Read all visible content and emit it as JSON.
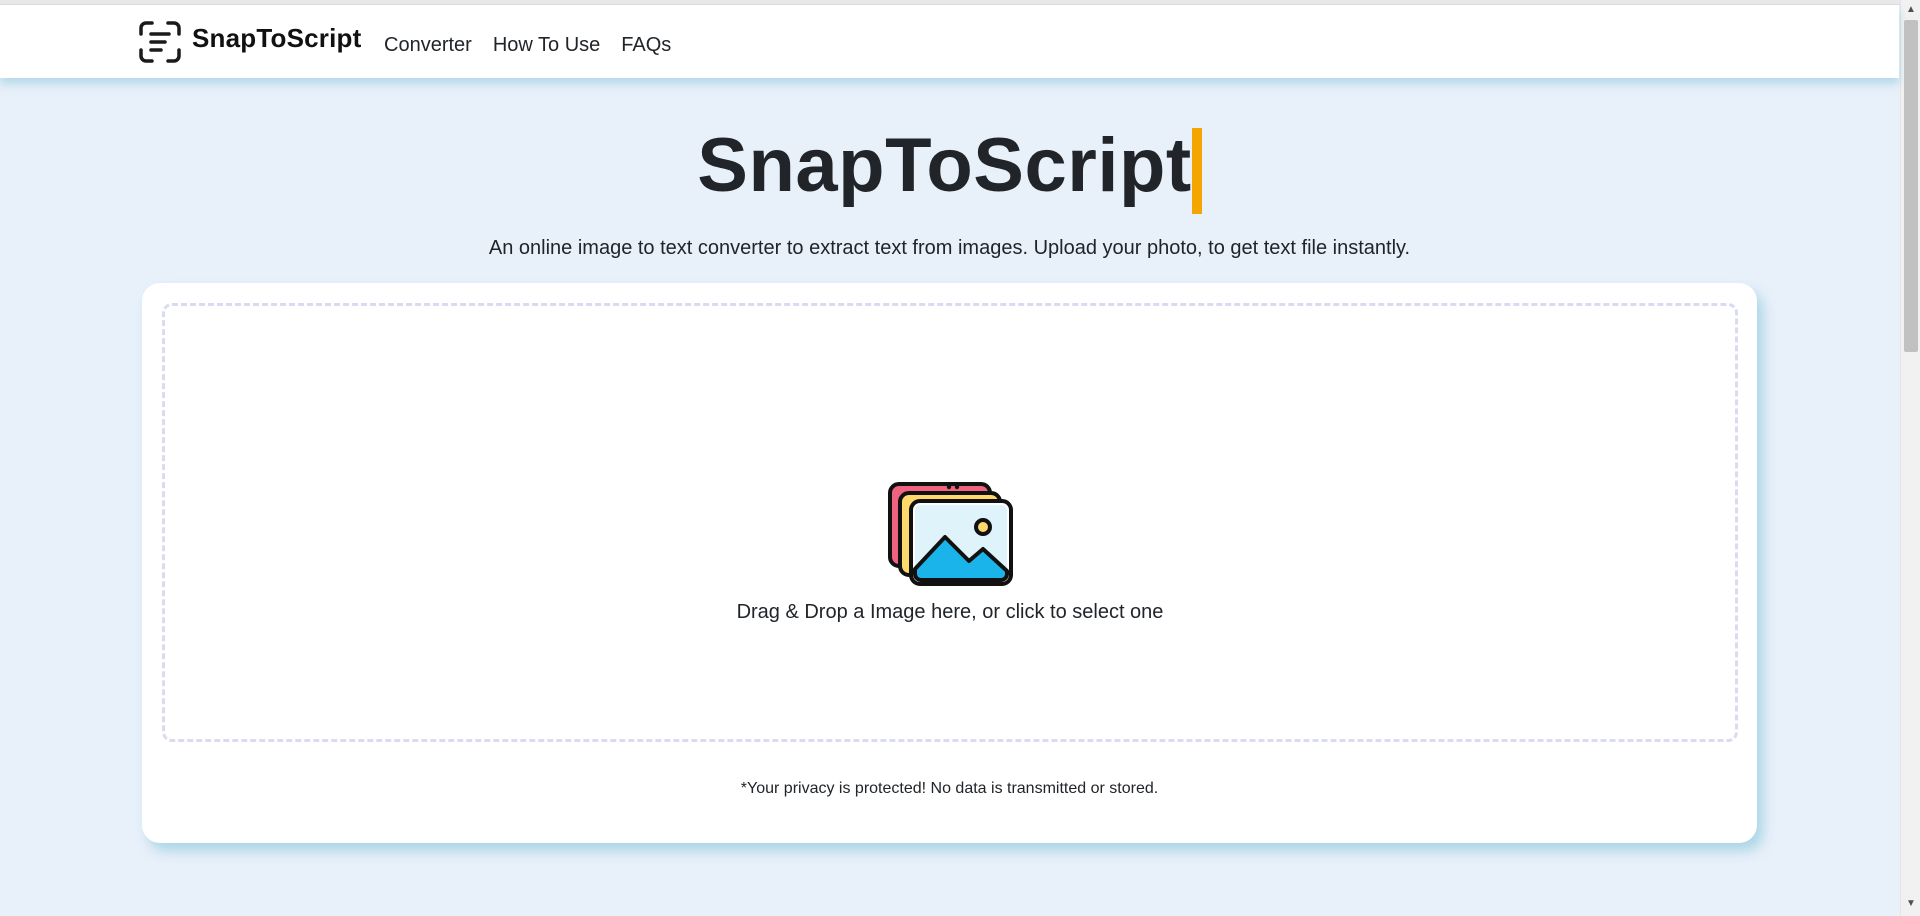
{
  "app": {
    "brand_name": "SnapToScript",
    "accent_color": "#f5a500",
    "background_color": "#e8f0fa"
  },
  "nav": {
    "links": [
      {
        "label": "Converter"
      },
      {
        "label": "How To Use"
      },
      {
        "label": "FAQs"
      }
    ]
  },
  "hero": {
    "title": "SnapToScript",
    "subtitle": "An online image to text converter to extract text from images. Upload your photo, to get text file instantly."
  },
  "upload": {
    "icon": "images-stack-icon",
    "prompt": "Drag & Drop a Image here, or click to select one",
    "privacy_note": "*Your privacy is protected! No data is transmitted or stored."
  },
  "scrollbar": {
    "up_glyph": "▲",
    "down_glyph": "▼"
  }
}
